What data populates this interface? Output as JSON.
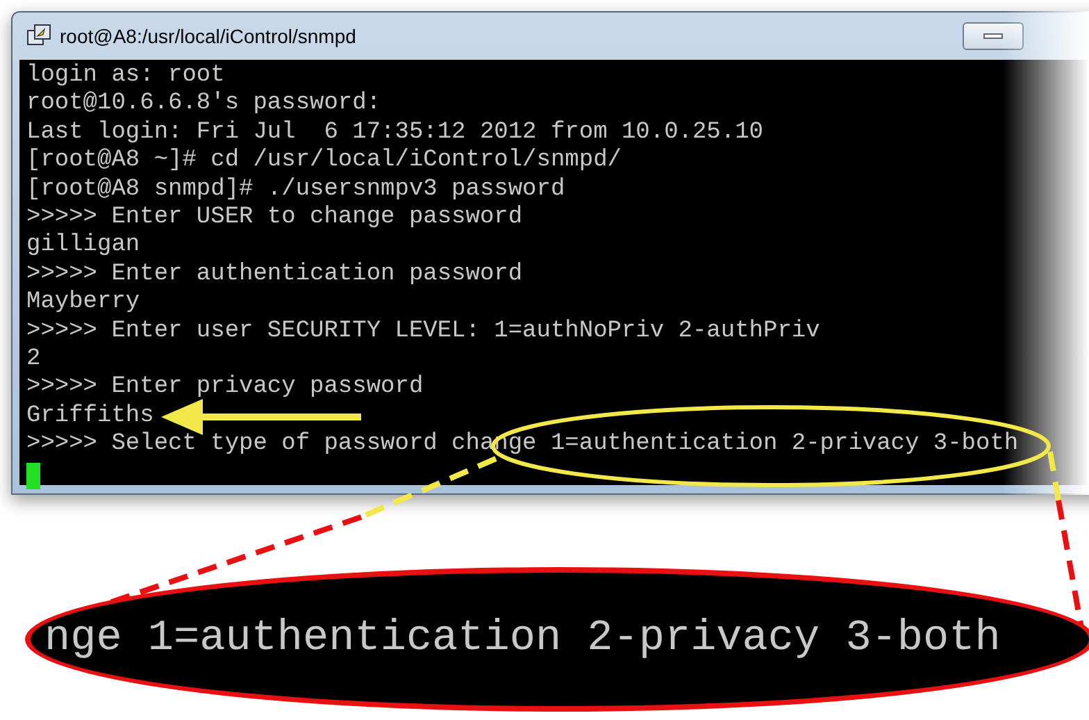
{
  "window": {
    "title": "root@A8:/usr/local/iControl/snmpd"
  },
  "terminal": {
    "lines": [
      "login as: root",
      "root@10.6.6.8's password:",
      "Last login: Fri Jul  6 17:35:12 2012 from 10.0.25.10",
      "[root@A8 ~]# cd /usr/local/iControl/snmpd/",
      "[root@A8 snmpd]# ./usersnmpv3 password",
      ">>>>> Enter USER to change password",
      "gilligan",
      ">>>>> Enter authentication password",
      "Mayberry",
      ">>>>> Enter user SECURITY LEVEL: 1=authNoPriv 2-authPriv",
      "2",
      ">>>>> Enter privacy password",
      "Griffiths",
      ">>>>> Select type of password change 1=authentication 2-privacy 3-both"
    ]
  },
  "zoom_callout": {
    "text": "nge 1=authentication 2-privacy 3-both"
  }
}
